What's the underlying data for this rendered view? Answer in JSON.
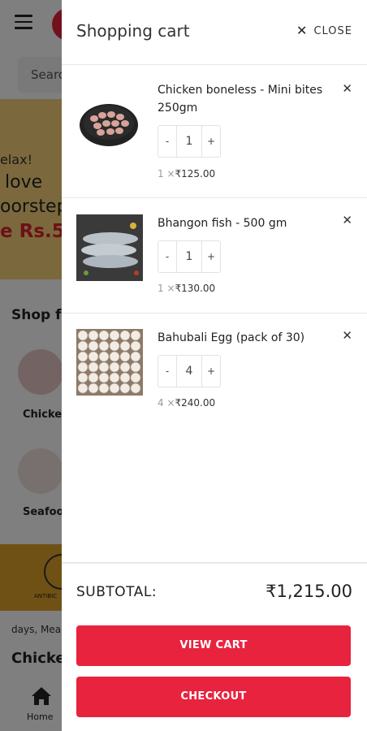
{
  "background": {
    "search_placeholder": "Searc",
    "banner_line1": "elax!",
    "banner_line2": "love",
    "banner_line3": "oorstep",
    "banner_line4": "e Rs.50",
    "shop_title": "Shop fr",
    "category1_label": "Chicke",
    "category2_label": "Seafoo",
    "strip_text": "ANTIBIC",
    "days_text": "days, Mea",
    "chicken_heading": "Chicke",
    "home_label": "Home"
  },
  "cart": {
    "title": "Shopping cart",
    "close_label": "CLOSE",
    "items": [
      {
        "name": "Chicken boneless - Mini bites 250gm",
        "quantity": "1",
        "minus": "-",
        "plus": "+",
        "qty_prefix": "1 ×",
        "unit_price": "₹125.00",
        "image": "chicken-bites-image"
      },
      {
        "name": "Bhangon fish - 500 gm",
        "quantity": "1",
        "minus": "-",
        "plus": "+",
        "qty_prefix": "1 ×",
        "unit_price": "₹130.00",
        "image": "fish-image"
      },
      {
        "name": "Bahubali Egg (pack of 30)",
        "quantity": "4",
        "minus": "-",
        "plus": "+",
        "qty_prefix": "4 ×",
        "unit_price": "₹240.00",
        "image": "egg-tray-image"
      }
    ],
    "subtotal_label": "SUBTOTAL:",
    "subtotal_value": "₹1,215.00",
    "view_cart_label": "VIEW CART",
    "checkout_label": "CHECKOUT"
  },
  "colors": {
    "accent": "#e8233e",
    "overlay": "rgba(0,0,0,0.5)"
  }
}
